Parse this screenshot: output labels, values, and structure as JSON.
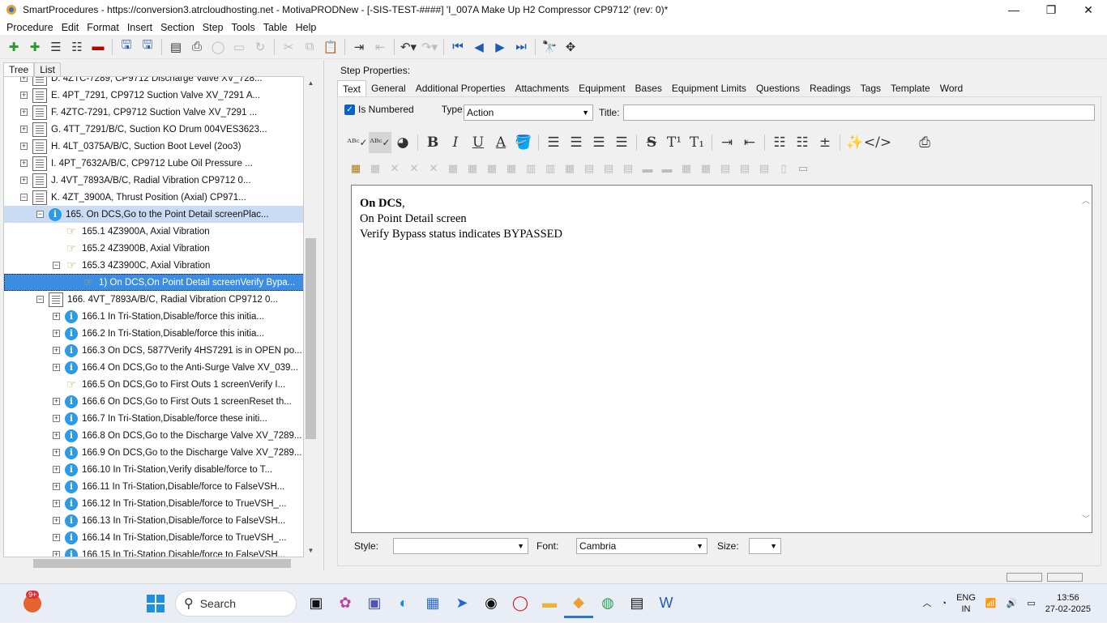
{
  "window": {
    "title": "SmartProcedures - https://conversion3.atrcloudhosting.net - MotivaPRODNew - [-SIS-TEST-####] 'I_007A Make Up H2 Compressor CP9712' (rev: 0)*",
    "minimize": "—",
    "maximize": "❐",
    "close": "✕"
  },
  "menu": [
    "Procedure",
    "Edit",
    "Format",
    "Insert",
    "Section",
    "Step",
    "Tools",
    "Table",
    "Help"
  ],
  "left": {
    "tabs": [
      "Tree",
      "List"
    ],
    "tree": [
      {
        "indent": 1,
        "exp": "+",
        "icon": "doc",
        "label": "D. 4ZTC-7289, CP9712 Discharge Valve XV_728..."
      },
      {
        "indent": 1,
        "exp": "+",
        "icon": "doc",
        "label": "E. 4PT_7291, CP9712 Suction Valve XV_7291 A..."
      },
      {
        "indent": 1,
        "exp": "+",
        "icon": "doc",
        "label": "F. 4ZTC-7291, CP9712 Suction Valve XV_7291 ..."
      },
      {
        "indent": 1,
        "exp": "+",
        "icon": "doc",
        "label": "G. 4TT_7291/B/C, Suction KO Drum 004VES3623..."
      },
      {
        "indent": 1,
        "exp": "+",
        "icon": "doc",
        "label": "H. 4LT_0375A/B/C, Suction Boot Level (2oo3)"
      },
      {
        "indent": 1,
        "exp": "+",
        "icon": "doc",
        "label": "I. 4PT_7632A/B/C, CP9712 Lube Oil Pressure ..."
      },
      {
        "indent": 1,
        "exp": "+",
        "icon": "doc",
        "label": "J. 4VT_7893A/B/C, Radial Vibration CP9712 0..."
      },
      {
        "indent": 1,
        "exp": "−",
        "icon": "doc",
        "label": "K. 4ZT_3900A, Thrust Position (Axial) CP971..."
      },
      {
        "indent": 2,
        "exp": "−",
        "icon": "info",
        "label": "165. On DCS,Go to the Point Detail screenPlac...",
        "state": "sel"
      },
      {
        "indent": 3,
        "exp": "",
        "icon": "hand",
        "label": "165.1 4Z3900A, Axial Vibration"
      },
      {
        "indent": 3,
        "exp": "",
        "icon": "hand",
        "label": "165.2 4Z3900B, Axial Vibration"
      },
      {
        "indent": 3,
        "exp": "−",
        "icon": "hand",
        "label": "165.3 4Z3900C, Axial Vibration"
      },
      {
        "indent": 4,
        "exp": "",
        "icon": "hand",
        "label": "1) On DCS,On Point Detail screenVerify Bypa...",
        "state": "sel2"
      },
      {
        "indent": 2,
        "exp": "−",
        "icon": "doc",
        "label": "166. 4VT_7893A/B/C, Radial Vibration CP9712 0..."
      },
      {
        "indent": 3,
        "exp": "+",
        "icon": "info",
        "label": "166.1 In Tri-Station,Disable/force this initia..."
      },
      {
        "indent": 3,
        "exp": "+",
        "icon": "info",
        "label": "166.2 In Tri-Station,Disable/force this initia..."
      },
      {
        "indent": 3,
        "exp": "+",
        "icon": "info",
        "label": "166.3 On DCS, 5877Verify 4HS7291 is in OPEN po..."
      },
      {
        "indent": 3,
        "exp": "+",
        "icon": "info",
        "label": "166.4 On DCS,Go to the Anti-Surge Valve XV_039..."
      },
      {
        "indent": 3,
        "exp": "",
        "icon": "hand",
        "label": "166.5 On DCS,Go to First Outs 1 screenVerify I..."
      },
      {
        "indent": 3,
        "exp": "+",
        "icon": "info",
        "label": "166.6 On DCS,Go to First Outs 1 screenReset th..."
      },
      {
        "indent": 3,
        "exp": "+",
        "icon": "info",
        "label": "166.7 In Tri-Station,Disable/force these initi..."
      },
      {
        "indent": 3,
        "exp": "+",
        "icon": "info",
        "label": "166.8 On DCS,Go to the Discharge Valve XV_7289..."
      },
      {
        "indent": 3,
        "exp": "+",
        "icon": "info",
        "label": "166.9 On DCS,Go to the Discharge Valve XV_7289..."
      },
      {
        "indent": 3,
        "exp": "+",
        "icon": "info",
        "label": "166.10 In Tri-Station,Verify disable/force to T..."
      },
      {
        "indent": 3,
        "exp": "+",
        "icon": "info",
        "label": "166.11 In Tri-Station,Disable/force to FalseVSH..."
      },
      {
        "indent": 3,
        "exp": "+",
        "icon": "info",
        "label": "166.12 In Tri-Station,Disable/force to TrueVSH_..."
      },
      {
        "indent": 3,
        "exp": "+",
        "icon": "info",
        "label": "166.13 In Tri-Station,Disable/force to FalseVSH..."
      },
      {
        "indent": 3,
        "exp": "+",
        "icon": "info",
        "label": "166.14 In Tri-Station,Disable/force to TrueVSH_..."
      },
      {
        "indent": 3,
        "exp": "+",
        "icon": "info",
        "label": "166.15 In Tri-Station,Disable/force to FalseVSH..."
      }
    ]
  },
  "right": {
    "header": "Step Properties:",
    "tabs": [
      "Text",
      "General",
      "Additional Properties",
      "Attachments",
      "Equipment",
      "Bases",
      "Equipment Limits",
      "Questions",
      "Readings",
      "Tags",
      "Template",
      "Word"
    ],
    "is_numbered_label": "Is Numbered",
    "is_numbered_check": "✓",
    "type_label": "Type:",
    "type_value": "Action",
    "title_label": "Title:",
    "title_value": "",
    "editor": {
      "line1_bold": "On DCS",
      "line1_rest": ",",
      "line2": "On Point Detail screen",
      "line3": "Verify Bypass status indicates BYPASSED"
    },
    "style_label": "Style:",
    "style_value": "",
    "font_label": "Font:",
    "font_value": "Cambria",
    "size_label": "Size:",
    "size_value": ""
  },
  "taskbar": {
    "badge": "9+",
    "search": "Search",
    "lang1": "ENG",
    "lang2": "IN",
    "time": "13:56",
    "date": "27-02-2025"
  }
}
